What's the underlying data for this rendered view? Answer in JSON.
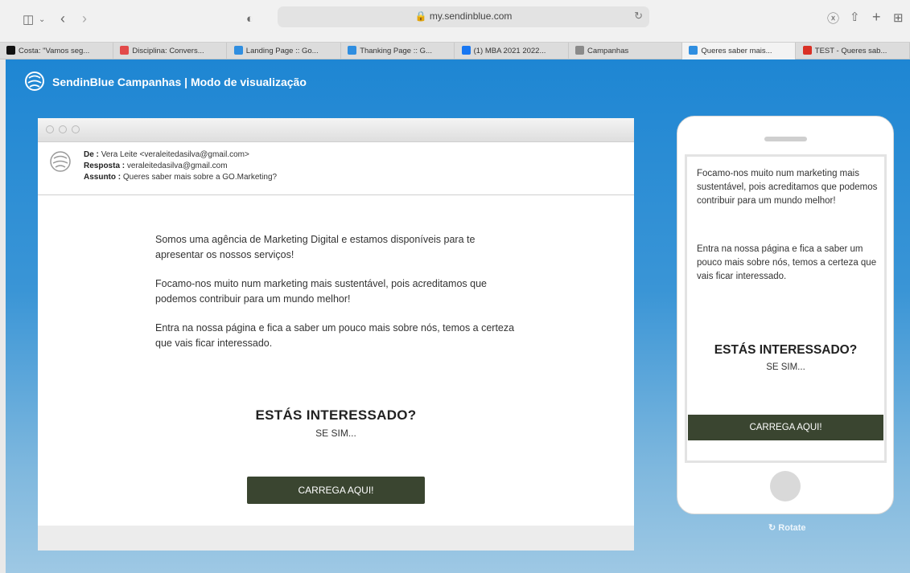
{
  "browser": {
    "url": "my.sendinblue.com",
    "tabs": [
      {
        "label": "Costa: \"Vamos seg...",
        "color": "#111111"
      },
      {
        "label": "Disciplina: Convers...",
        "color": "#e24a4a"
      },
      {
        "label": "Landing Page :: Go...",
        "color": "#2f8ee0"
      },
      {
        "label": "Thanking Page :: G...",
        "color": "#2f8ee0"
      },
      {
        "label": "(1) MBA 2021 2022...",
        "color": "#1877f2"
      },
      {
        "label": "Campanhas",
        "color": "#8a8a8a"
      },
      {
        "label": "Queres saber mais...",
        "color": "#2f8ee0"
      },
      {
        "label": "TEST - Queres sab...",
        "color": "#d93025"
      }
    ],
    "active_tab": 6
  },
  "app": {
    "title": "SendinBlue Campanhas | Modo de visualização"
  },
  "email": {
    "from_label": "De :",
    "from_value": "Vera Leite <veraleitedasilva@gmail.com>",
    "reply_label": "Resposta :",
    "reply_value": "veraleitedasilva@gmail.com",
    "subject_label": "Assunto :",
    "subject_value": "Queres saber mais sobre a GO.Marketing?",
    "paragraph1": "Somos uma agência de Marketing Digital e estamos disponíveis para te apresentar os nossos serviços!",
    "paragraph2": "Focamo-nos muito num marketing mais sustentável, pois acreditamos que podemos contribuir para um mundo melhor!",
    "paragraph3": "Entra na nossa página e fica a saber um pouco mais sobre nós, temos a certeza que vais ficar interessado.",
    "cta_title": "ESTÁS INTERESSADO?",
    "cta_sub": "SE SIM...",
    "cta_button": "CARREGA AQUI!"
  },
  "mobile": {
    "rotate_label": "Rotate"
  },
  "colors": {
    "button_bg": "#3a4530",
    "page_gradient_top": "#1e86d3",
    "page_gradient_bottom": "#9ec8e4"
  }
}
